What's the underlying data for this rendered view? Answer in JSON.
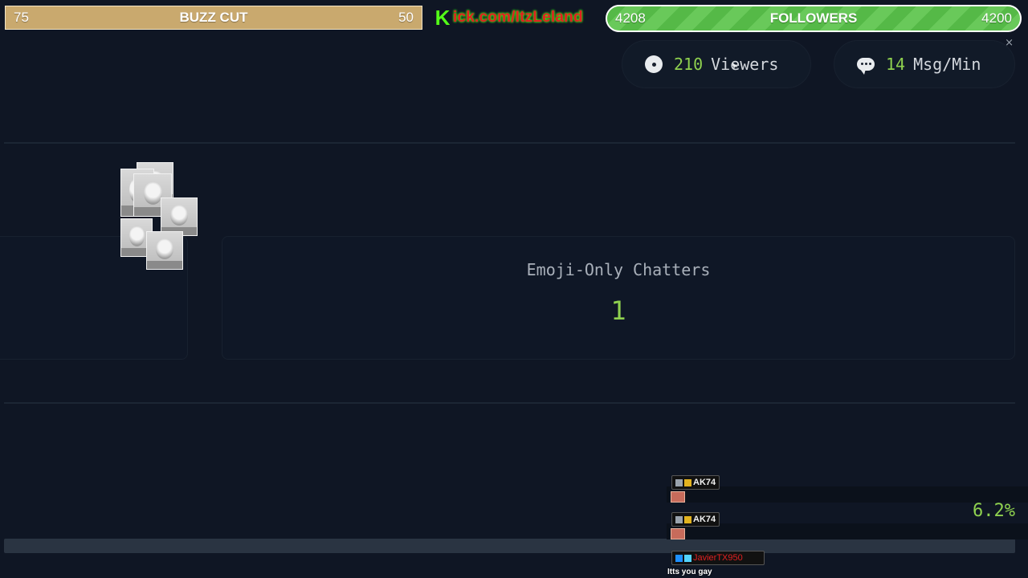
{
  "goal_left": {
    "left_value": "75",
    "title": "BUZZ CUT",
    "right_value": "50"
  },
  "kick": {
    "logo": "K",
    "url": "ick.com/ItzLeland"
  },
  "goal_right": {
    "left_value": "4208",
    "title": "FOLLOWERS",
    "right_value": "4200"
  },
  "close_label": "×",
  "stats": {
    "viewers": {
      "number": "210",
      "label": "Viewers",
      "icon": "eye-icon"
    },
    "messages": {
      "number": "14",
      "label": "Msg/Min",
      "icon": "chat-bubble-icon"
    }
  },
  "card": {
    "title": "Emoji-Only Chatters",
    "value": "1"
  },
  "progress": {
    "percent_label": "6.2%",
    "value": 0.062
  },
  "chat": {
    "messages": [
      {
        "user": "AK74",
        "badges": [
          "moderator",
          "subscriber"
        ],
        "content": "emote",
        "name_color": "#f1f1f1"
      },
      {
        "user": "AK74",
        "badges": [
          "moderator",
          "subscriber"
        ],
        "content": "emote",
        "name_color": "#f1f1f1"
      },
      {
        "user": "JavierTX950",
        "badges": [
          "verified",
          "subscriber"
        ],
        "content": "Itts you gay",
        "name_color": "#e02020"
      }
    ]
  },
  "colors": {
    "accent_green": "#8fd14f",
    "kick_green": "#53fc18",
    "goal_gold": "#c9a96e",
    "background": "#0f1624"
  }
}
